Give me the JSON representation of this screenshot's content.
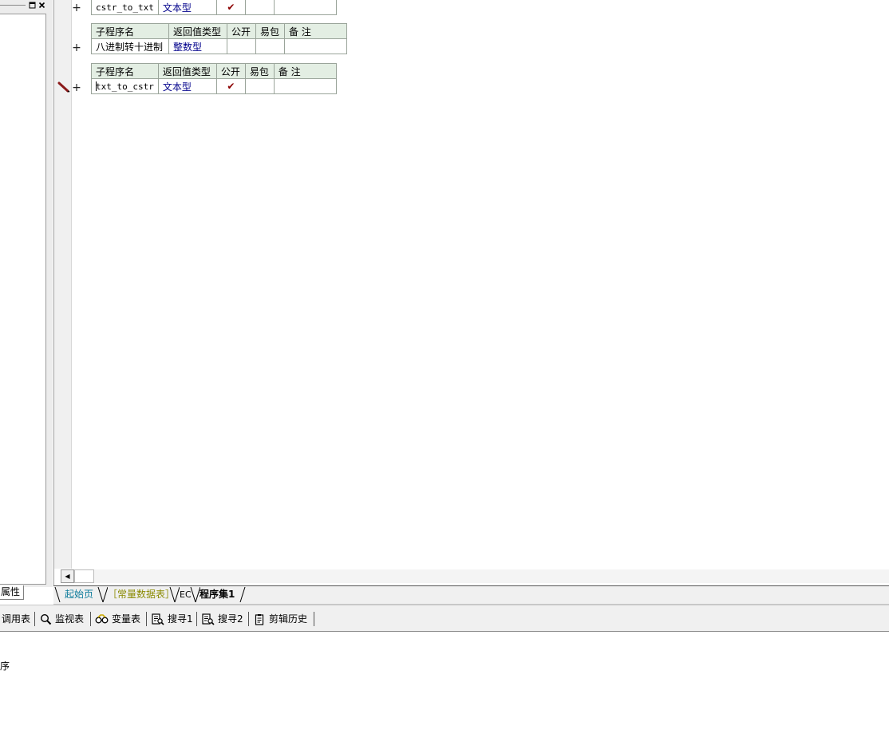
{
  "left_panel": {
    "restore_glyph": "▫",
    "close_glyph": "×",
    "tab_label": "属性"
  },
  "subprograms": [
    {
      "headers": [
        "子程序名",
        "返回值类型",
        "公开",
        "易包",
        "备 注"
      ],
      "name": "cstr_to_txt",
      "return_type": "文本型",
      "public_mark": "✔",
      "easy_package": "",
      "remark": "",
      "expander": "+"
    },
    {
      "headers": [
        "子程序名",
        "返回值类型",
        "公开",
        "易包",
        "备 注"
      ],
      "name": "八进制转十进制",
      "return_type": "整数型",
      "public_mark": "",
      "easy_package": "",
      "remark": "",
      "expander": "+"
    },
    {
      "headers": [
        "子程序名",
        "返回值类型",
        "公开",
        "易包",
        "备 注"
      ],
      "name": "txt_to_cstr",
      "return_type": "文本型",
      "public_mark": "✔",
      "easy_package": "",
      "remark": "",
      "expander": "+"
    }
  ],
  "scrollbar": {
    "left_arrow": "◀"
  },
  "tabs": [
    {
      "label": "起始页",
      "color": "#0a7a9a"
    },
    {
      "label": "［常量数据表］",
      "color": "#8a8a00"
    },
    {
      "label": "EC",
      "color": "#000000"
    },
    {
      "label": "程序集1",
      "color": "#000000",
      "active": true
    }
  ],
  "toolbar": {
    "items": [
      {
        "label": "调用表",
        "icon": "none"
      },
      {
        "label": "监视表",
        "icon": "magnifier-icon"
      },
      {
        "label": "变量表",
        "icon": "binoculars-icon"
      },
      {
        "label": "搜寻1",
        "icon": "search-doc-icon"
      },
      {
        "label": "搜寻2",
        "icon": "search-doc-icon"
      },
      {
        "label": "剪辑历史",
        "icon": "clipboard-icon"
      }
    ]
  },
  "output": {
    "text": "序"
  }
}
